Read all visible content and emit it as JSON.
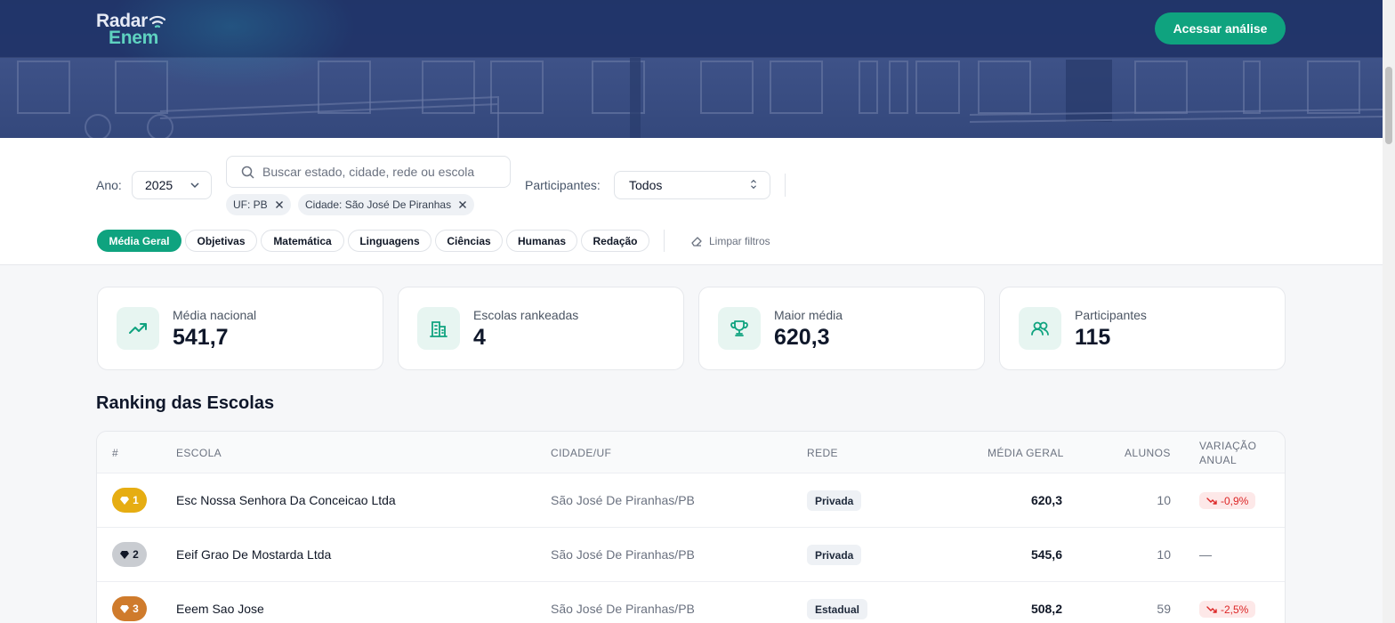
{
  "header": {
    "logo_top": "Radar",
    "logo_bottom": "Enem",
    "cta_label": "Acessar análise"
  },
  "filters": {
    "year_label": "Ano:",
    "year_value": "2025",
    "search_placeholder": "Buscar estado, cidade, rede ou escola",
    "participants_label": "Participantes:",
    "participants_value": "Todos",
    "chips": [
      "UF: PB",
      "Cidade: São José De Piranhas"
    ],
    "tabs": [
      "Média Geral",
      "Objetivas",
      "Matemática",
      "Linguagens",
      "Ciências",
      "Humanas",
      "Redação"
    ],
    "active_tab": "Média Geral",
    "clear_label": "Limpar filtros"
  },
  "stats": [
    {
      "label": "Média nacional",
      "value": "541,7",
      "icon": "trending-up-icon"
    },
    {
      "label": "Escolas rankeadas",
      "value": "4",
      "icon": "building-icon"
    },
    {
      "label": "Maior média",
      "value": "620,3",
      "icon": "trophy-icon"
    },
    {
      "label": "Participantes",
      "value": "115",
      "icon": "users-icon"
    }
  ],
  "ranking": {
    "title": "Ranking das Escolas",
    "columns": [
      "#",
      "ESCOLA",
      "CIDADE/UF",
      "REDE",
      "MÉDIA GERAL",
      "ALUNOS",
      "VARIAÇÃO",
      "ANUAL"
    ],
    "rows": [
      {
        "rank": "1",
        "school": "Esc Nossa Senhora Da Conceicao Ltda",
        "city": "São José De Piranhas/PB",
        "network": "Privada",
        "score": "620,3",
        "students": "10",
        "variation": "-0,9%",
        "badge_color": "#e6ad12"
      },
      {
        "rank": "2",
        "school": "Eeif Grao De Mostarda Ltda",
        "city": "São José De Piranhas/PB",
        "network": "Privada",
        "score": "545,6",
        "students": "10",
        "variation": "—",
        "badge_color": "#c9ccd1"
      },
      {
        "rank": "3",
        "school": "Eeem Sao Jose",
        "city": "São José De Piranhas/PB",
        "network": "Estadual",
        "score": "508,2",
        "students": "59",
        "variation": "-2,5%",
        "badge_color": "#cf7b2c"
      }
    ]
  },
  "colors": {
    "accent": "#0fa37f",
    "navy": "#243a70",
    "danger": "#dc2626"
  }
}
